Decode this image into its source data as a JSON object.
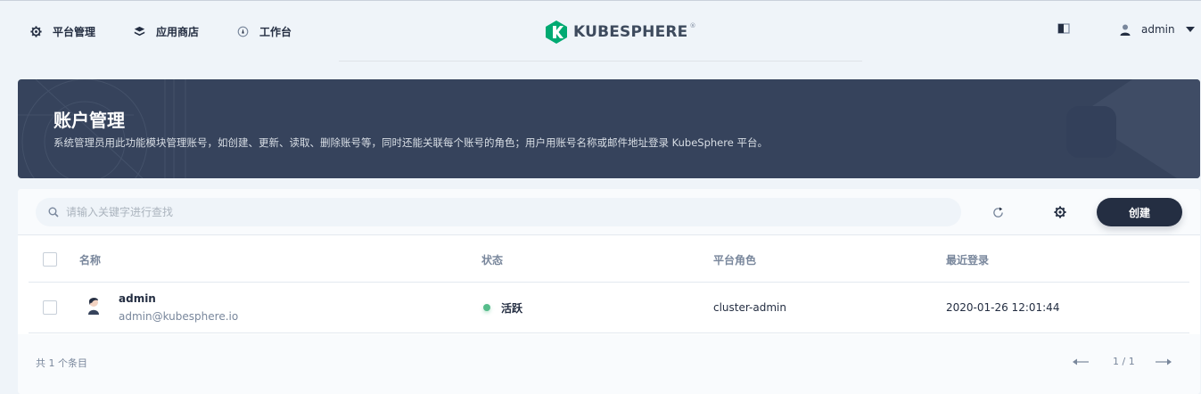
{
  "nav": {
    "left": [
      {
        "label": "平台管理",
        "icon": "gear-icon"
      },
      {
        "label": "应用商店",
        "icon": "app-store-icon"
      },
      {
        "label": "工作台",
        "icon": "dashboard-icon"
      }
    ],
    "logo_text": "KUBESPHERE",
    "logo_mark": "®",
    "user": "admin"
  },
  "banner": {
    "title": "账户管理",
    "description": "系统管理员用此功能模块管理账号，如创建、更新、读取、删除账号等，同时还能关联每个账号的角色；用户用账号名称或邮件地址登录 KubeSphere 平台。"
  },
  "toolbar": {
    "search_placeholder": "请输入关键字进行查找",
    "create_label": "创建"
  },
  "table": {
    "headers": {
      "name": "名称",
      "status": "状态",
      "role": "平台角色",
      "last_login": "最近登录"
    },
    "rows": [
      {
        "name": "admin",
        "email": "admin@kubesphere.io",
        "status": "活跃",
        "role": "cluster-admin",
        "last_login": "2020-01-26 12:01:44"
      }
    ]
  },
  "footer": {
    "total": "共 1 个条目",
    "page": "1 / 1"
  },
  "colors": {
    "accent": "#242e42",
    "banner": "#36435c",
    "status_active": "#55bc8a",
    "logo_green": "#00aa72"
  }
}
